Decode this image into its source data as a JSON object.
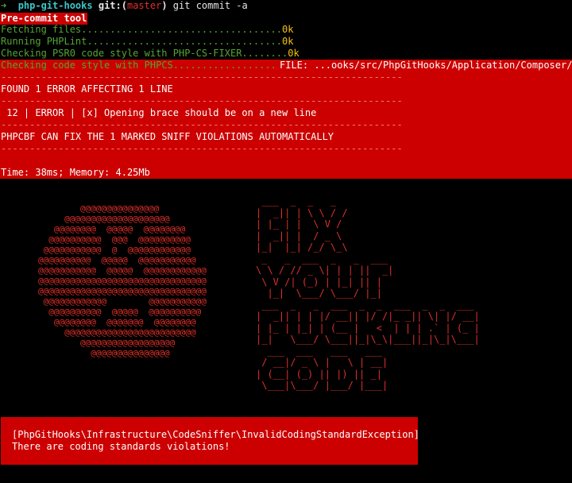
{
  "prompt": {
    "arrow": "➜",
    "dir": "php-git-hooks",
    "git_prefix": "git:(",
    "branch": "master",
    "git_suffix": ")",
    "command": "git commit -a"
  },
  "banner": "Pre-commit tool",
  "steps": [
    {
      "text": "Fetching files...................................",
      "status": "0k"
    },
    {
      "text": "Running PHPLint..................................",
      "status": "0k"
    },
    {
      "text": "Checking PSR0 code style with PHP-CS-FIXER........",
      "status": "0k"
    },
    {
      "text": "Checking code style with PHPCS.................."
    }
  ],
  "error_report": {
    "file_line": "FILE: ...ooks/src/PhpGitHooks/Application/Composer/Co",
    "separator": "----------------------------------------------------------------------",
    "found": "FOUND 1 ERROR AFFECTING 1 LINE",
    "detail": " 12 | ERROR | [x] Opening brace should be on a new line",
    "fixable": "PHPCBF CAN FIX THE 1 MARKED SNIFF VIOLATIONS AUTOMATICALLY",
    "timing": "Time: 38ms; Memory: 4.25Mb"
  },
  "art": {
    "face": "        @@@@@@@@@@@@@@@\n     @@@@@@@@@@@@@@@@@@@@\n   @@@@@@@@  @@@@@  @@@@@@@@\n  @@@@@@@@@@  @@@  @@@@@@@@@@\n @@@@@@@@@@@  @  @@@@@@@@@@@@\n@@@@@@@@@@  @@@@@  @@@@@@@@@@@\n@@@@@@@@@@@  @@@@@  @@@@@@@@@@@@\n@@@@@@@@@@@@@@@@@@@@@@@@@@@@@@@@\n@@@@@@@@@@@@@@@@@@@@@@@@@@@@@@@@\n @@@@@@@@@@@@        @@@@@@@@@@@\n  @@@@@@@@@@  @@@@@  @@@@@@@@@@\n   @@@@@@@@  @@@@@@@  @@@@@@@@\n     @@@@@@@@@@@@@@@@@@@@@@@@@\n        @@@@@@@@@@@@@@@@@@\n          @@@@@@@@@@@@@@@",
    "text": " ___  _  _   _\n|  _|| | \\ \\ / /\n| |_ | |  \\ V /\n|  _|| |  / _ \\\n|_|  |_| /_/ \\_\\\n _   _  ___  _   _  ___\n\\ \\ / // _ \\| | | ||  _|\n \\ V /| (_) | |_| || |\n  |_|  \\___/ \\___/ |_|\n ___  _   _  ___  _  _  ___  _  _  ___\n|  _|| | | |/ __|| |/ /|_ _|| \\| |/ __|\n| |_ | |_| | (__ |   <  | | | .` | (_ |\n|_|   \\___/ \\___||_|\\_\\|___||_|\\_|\\___|\n  ___  ___   ___   ___\n / __|/ _ \\ |   \\ | __|\n| (__| (_) || |) || _|\n \\___|\\___/ |___/ |___|"
  },
  "exception": {
    "name": "[PhpGitHooks\\Infrastructure\\CodeSniffer\\InvalidCodingStandardException]",
    "message": "There are coding standards violations!"
  },
  "colors": {
    "error_bg": "#cc0000",
    "step_text": "#55a533",
    "status_ok": "#f2c40a",
    "prompt_dir": "#3ec6c9",
    "branch": "#e0302a"
  }
}
